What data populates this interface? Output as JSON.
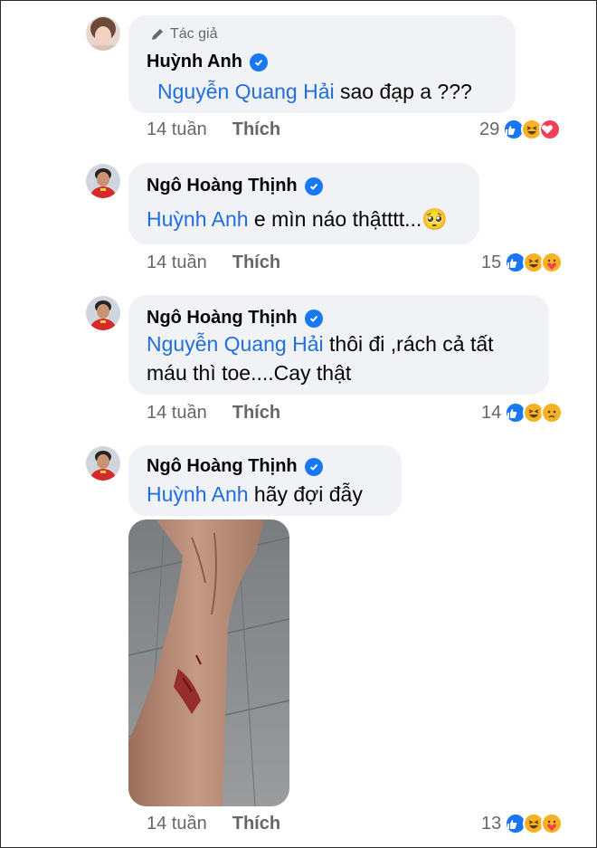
{
  "comments": [
    {
      "author_tag": "Tác giả",
      "name": "Huỳnh Anh",
      "mention": "Nguyễn Quang Hải",
      "text": " sao đạp a ???",
      "time": "14 tuần",
      "like_label": "Thích",
      "reaction_count": "29",
      "reactions": [
        "like-reaction-icon",
        "haha-reaction-icon",
        "love-reaction-icon"
      ]
    },
    {
      "name": "Ngô Hoàng Thịnh",
      "mention": "Huỳnh Anh",
      "text": " e mìn náo thậtttt...",
      "emoji": "🥺",
      "time": "14 tuần",
      "like_label": "Thích",
      "reaction_count": "15",
      "reactions": [
        "like-reaction-icon",
        "haha-reaction-icon",
        "care-reaction-icon"
      ]
    },
    {
      "name": "Ngô Hoàng Thịnh",
      "mention": "Nguyễn Quang Hải",
      "text": " thôi đi ,rách cả tất",
      "text2": "máu thì toe....Cay thật",
      "time": "14 tuần",
      "like_label": "Thích",
      "reaction_count": "14",
      "reactions": [
        "like-reaction-icon",
        "haha-reaction-icon",
        "sad-reaction-icon"
      ]
    },
    {
      "name": "Ngô Hoàng Thịnh",
      "mention": "Huỳnh Anh",
      "text": " hãy đợi đẫy",
      "time": "14 tuần",
      "like_label": "Thích",
      "reaction_count": "13",
      "reactions": [
        "like-reaction-icon",
        "haha-reaction-icon",
        "care-reaction-icon"
      ]
    }
  ],
  "colors": {
    "bubble": "#f0f2f5",
    "mention": "#216fdb",
    "verified": "#1877f2",
    "meta": "#65676b"
  }
}
